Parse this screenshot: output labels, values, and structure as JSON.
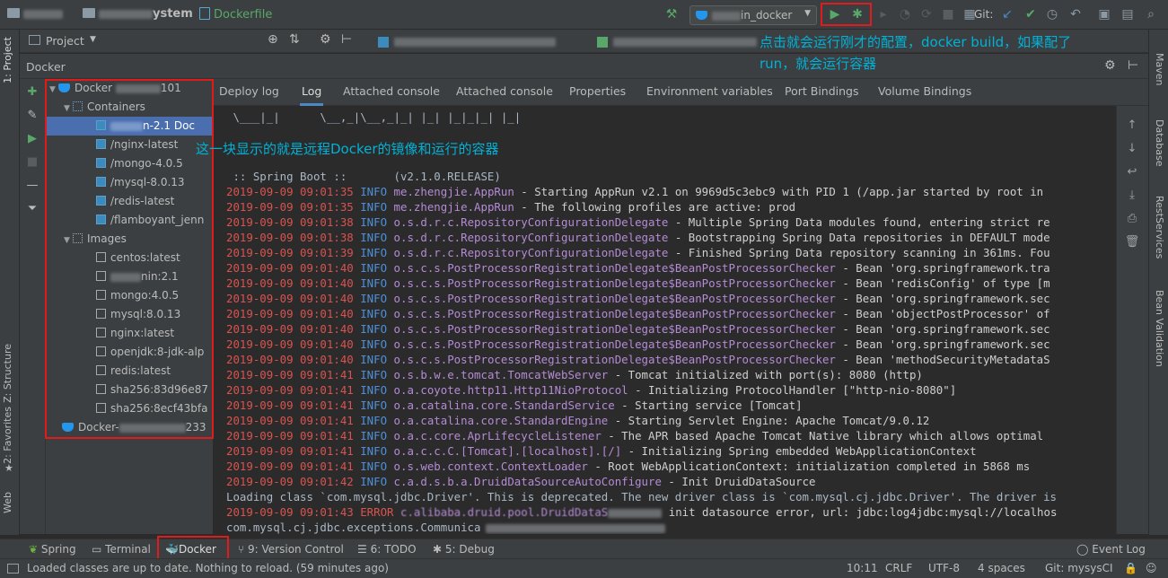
{
  "nav": {
    "project_suffix": "ystem",
    "file": "Dockerfile",
    "run_config": "in_docker",
    "git_label": "Git:"
  },
  "project_panel": {
    "title": "Project"
  },
  "docker_panel": {
    "title": "Docker",
    "tree": {
      "host1": "Docker",
      "host1_suffix": "101",
      "containers_label": "Containers",
      "containers": [
        "n-2.1 Doc",
        "/nginx-latest",
        "/mongo-4.0.5",
        "/mysql-8.0.13",
        "/redis-latest",
        "/flamboyant_jenn"
      ],
      "images_label": "Images",
      "images": [
        "centos:latest",
        "nin:2.1",
        "mongo:4.0.5",
        "mysql:8.0.13",
        "nginx:latest",
        "openjdk:8-jdk-alp",
        "redis:latest",
        "sha256:83d96e87",
        "sha256:8ecf43bfa"
      ],
      "host2": "Docker-",
      "host2_suffix": "233"
    }
  },
  "detail_tabs": [
    "Deploy log",
    "Log",
    "Attached console",
    "Attached console",
    "Properties",
    "Environment variables",
    "Port Bindings",
    "Volume Bindings"
  ],
  "log": {
    "banner": " \\___|_|      \\__,_|\\__,_|_| |_| |_|_|_| |_|",
    "spring_boot": " :: Spring Boot ::       (v2.1.0.RELEASE)",
    "lines": [
      {
        "ts": "2019-09-09 09:01:35",
        "level": "INFO",
        "logger": "me.zhengjie.AppRun",
        "msg": " - Starting AppRun v2.1 on 9969d5c3ebc9 with PID 1 (/app.jar started by root in"
      },
      {
        "ts": "2019-09-09 09:01:35",
        "level": "INFO",
        "logger": "me.zhengjie.AppRun",
        "msg": " - The following profiles are active: prod"
      },
      {
        "ts": "2019-09-09 09:01:38",
        "level": "INFO",
        "logger": "o.s.d.r.c.RepositoryConfigurationDelegate",
        "msg": " - Multiple Spring Data modules found, entering strict re"
      },
      {
        "ts": "2019-09-09 09:01:38",
        "level": "INFO",
        "logger": "o.s.d.r.c.RepositoryConfigurationDelegate",
        "msg": " - Bootstrapping Spring Data repositories in DEFAULT mode"
      },
      {
        "ts": "2019-09-09 09:01:39",
        "level": "INFO",
        "logger": "o.s.d.r.c.RepositoryConfigurationDelegate",
        "msg": " - Finished Spring Data repository scanning in 361ms. Fou"
      },
      {
        "ts": "2019-09-09 09:01:40",
        "level": "INFO",
        "logger": "o.s.c.s.PostProcessorRegistrationDelegate$BeanPostProcessorChecker",
        "msg": " - Bean 'org.springframework.tra"
      },
      {
        "ts": "2019-09-09 09:01:40",
        "level": "INFO",
        "logger": "o.s.c.s.PostProcessorRegistrationDelegate$BeanPostProcessorChecker",
        "msg": " - Bean 'redisConfig' of type [m"
      },
      {
        "ts": "2019-09-09 09:01:40",
        "level": "INFO",
        "logger": "o.s.c.s.PostProcessorRegistrationDelegate$BeanPostProcessorChecker",
        "msg": " - Bean 'org.springframework.sec"
      },
      {
        "ts": "2019-09-09 09:01:40",
        "level": "INFO",
        "logger": "o.s.c.s.PostProcessorRegistrationDelegate$BeanPostProcessorChecker",
        "msg": " - Bean 'objectPostProcessor' of"
      },
      {
        "ts": "2019-09-09 09:01:40",
        "level": "INFO",
        "logger": "o.s.c.s.PostProcessorRegistrationDelegate$BeanPostProcessorChecker",
        "msg": " - Bean 'org.springframework.sec"
      },
      {
        "ts": "2019-09-09 09:01:40",
        "level": "INFO",
        "logger": "o.s.c.s.PostProcessorRegistrationDelegate$BeanPostProcessorChecker",
        "msg": " - Bean 'org.springframework.sec"
      },
      {
        "ts": "2019-09-09 09:01:40",
        "level": "INFO",
        "logger": "o.s.c.s.PostProcessorRegistrationDelegate$BeanPostProcessorChecker",
        "msg": " - Bean 'methodSecurityMetadataS"
      },
      {
        "ts": "2019-09-09 09:01:41",
        "level": "INFO",
        "logger": "o.s.b.w.e.tomcat.TomcatWebServer",
        "msg": " - Tomcat initialized with port(s): 8080 (http)"
      },
      {
        "ts": "2019-09-09 09:01:41",
        "level": "INFO",
        "logger": "o.a.coyote.http11.Http11NioProtocol",
        "msg": " - Initializing ProtocolHandler [\"http-nio-8080\"]"
      },
      {
        "ts": "2019-09-09 09:01:41",
        "level": "INFO",
        "logger": "o.a.catalina.core.StandardService",
        "msg": " - Starting service [Tomcat]"
      },
      {
        "ts": "2019-09-09 09:01:41",
        "level": "INFO",
        "logger": "o.a.catalina.core.StandardEngine",
        "msg": " - Starting Servlet Engine: Apache Tomcat/9.0.12"
      },
      {
        "ts": "2019-09-09 09:01:41",
        "level": "INFO",
        "logger": "o.a.c.core.AprLifecycleListener",
        "msg": " - The APR based Apache Tomcat Native library which allows optimal"
      },
      {
        "ts": "2019-09-09 09:01:41",
        "level": "INFO",
        "logger": "o.a.c.c.C.[Tomcat].[localhost].[/]",
        "msg": " - Initializing Spring embedded WebApplicationContext"
      },
      {
        "ts": "2019-09-09 09:01:41",
        "level": "INFO",
        "logger": "o.s.web.context.ContextLoader",
        "msg": " - Root WebApplicationContext: initialization completed in 5868 ms"
      },
      {
        "ts": "2019-09-09 09:01:42",
        "level": "INFO",
        "logger": "c.a.d.s.b.a.DruidDataSourceAutoConfigure",
        "msg": " - Init DruidDataSource"
      }
    ],
    "plain1": "Loading class `com.mysql.jdbc.Driver'. This is deprecated. The new driver class is `com.mysql.cj.jdbc.Driver'. The driver is",
    "err_ts": "2019-09-09 09:01:43",
    "err_level": "ERROR",
    "err_logger": "c.alibaba.druid.pool.DruidDataS",
    "err_msg": "init datasource error, url: jdbc:log4jdbc:mysql://localhos",
    "plain2": "com.mysql.cj.jdbc.exceptions.Communica"
  },
  "annotations": {
    "top": "点击就会运行刚才的配置，docker build，如果配了",
    "top2": "run，就会运行容器",
    "tree": "这一块显示的就是远程Docker的镜像和运行的容器"
  },
  "left_tabs": [
    "1: Project",
    "Z: Structure",
    "2: Favorites",
    "Web"
  ],
  "right_tabs": [
    "Maven",
    "Database",
    "RestServices",
    "Bean Validation"
  ],
  "bottom_tabs": {
    "spring": "Spring",
    "terminal": "Terminal",
    "docker": "Docker",
    "vcs": "9: Version Control",
    "todo": "6: TODO",
    "debug": "5: Debug",
    "event_log": "Event Log"
  },
  "status": {
    "message": "Loaded classes are up to date. Nothing to reload. (59 minutes ago)",
    "position": "10:11",
    "line_sep": "CRLF",
    "encoding": "UTF-8",
    "indent": "4 spaces",
    "git": "Git: mysysCI"
  },
  "colors": {
    "accent": "#4a88c7",
    "annotation": "#00b2d6",
    "highlight_box": "#e01b1b",
    "run_green": "#59a869"
  }
}
